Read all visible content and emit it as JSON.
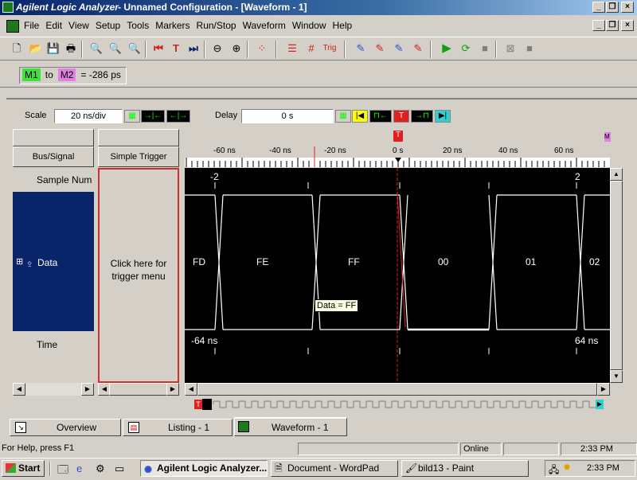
{
  "titlebar": {
    "app": "Agilent Logic Analyzer",
    "doc": "- Unnamed Configuration - [Waveform - 1]"
  },
  "menu": [
    "File",
    "Edit",
    "View",
    "Setup",
    "Tools",
    "Markers",
    "Run/Stop",
    "Waveform",
    "Window",
    "Help"
  ],
  "markers": {
    "m1": "M1",
    "to": "to",
    "m2": "M2",
    "value": "= -286 ps"
  },
  "controls": {
    "scale_label": "Scale",
    "scale_value": "20 ns/div",
    "delay_label": "Delay",
    "delay_value": "0 s"
  },
  "left_panel": {
    "bus_signal": "Bus/Signal",
    "simple_trigger": "Simple Trigger",
    "sample_num": "Sample Num",
    "data": "Data",
    "time": "Time",
    "trigger_hint": "Click here for trigger menu"
  },
  "ruler": {
    "ticks": [
      "-60 ns",
      "-40 ns",
      "-20 ns",
      "0 s",
      "20 ns",
      "40 ns",
      "60 ns"
    ],
    "trigger_marker": "T",
    "m_marker": "M"
  },
  "waveform": {
    "sample_left": "-2",
    "sample_right": "2",
    "values": [
      "FD",
      "FE",
      "FF",
      "00",
      "01",
      "02"
    ],
    "tooltip": "Data = FF",
    "time_left": "-64 ns",
    "time_right": "64 ns"
  },
  "tabs": [
    "Overview",
    "Listing - 1",
    "Waveform - 1"
  ],
  "statusbar": {
    "help": "For Help, press F1",
    "online": "Online",
    "time": "2:33 PM"
  },
  "taskbar": {
    "start": "Start",
    "tasks": [
      "Agilent Logic Analyzer...",
      "Document - WordPad",
      "bild13 - Paint"
    ],
    "clock": "2:33 PM"
  },
  "colors": {
    "waveform_bg": "#000000",
    "trace": "#ffffff",
    "bus_panel": "#0a246a",
    "m1": "#40e040",
    "m2": "#e080e0",
    "trigger_red": "#e02020"
  }
}
